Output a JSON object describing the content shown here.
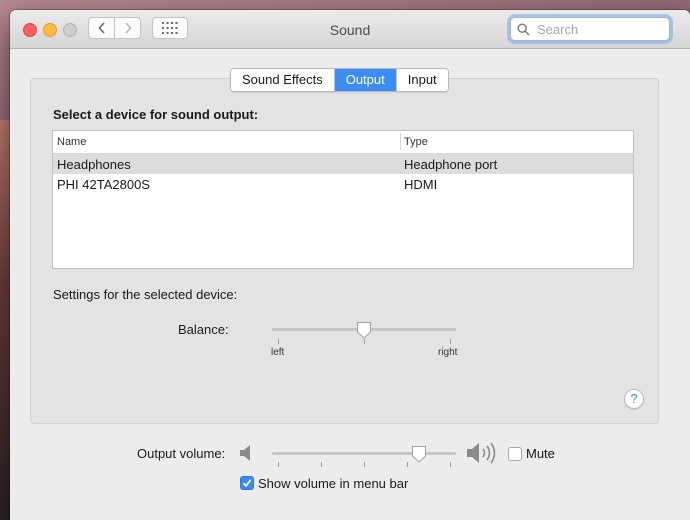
{
  "window": {
    "title": "Sound"
  },
  "search": {
    "placeholder": "Search",
    "value": ""
  },
  "tabs": [
    {
      "label": "Sound Effects",
      "active": false
    },
    {
      "label": "Output",
      "active": true
    },
    {
      "label": "Input",
      "active": false
    }
  ],
  "output": {
    "heading": "Select a device for sound output:",
    "columns": {
      "name": "Name",
      "type": "Type"
    },
    "devices": [
      {
        "name": "Headphones",
        "type": "Headphone port",
        "selected": true
      },
      {
        "name": "PHI 42TA2800S",
        "type": "HDMI",
        "selected": false
      }
    ],
    "settings_label": "Settings for the selected device:",
    "balance": {
      "label": "Balance:",
      "left_label": "left",
      "right_label": "right",
      "value": 0.5
    }
  },
  "help": {
    "label": "?"
  },
  "footer": {
    "output_volume_label": "Output volume:",
    "volume_value": 0.8,
    "mute_label": "Mute",
    "mute_checked": false,
    "show_volume_label": "Show volume in menu bar",
    "show_volume_checked": true
  },
  "colors": {
    "accent": "#3b8cf5",
    "selected_row": "#dcdcdc"
  },
  "icons": {
    "back": "chevron-left-icon",
    "forward": "chevron-right-icon",
    "show_all": "grid-icon",
    "search": "search-icon",
    "volume_low": "speaker-low-icon",
    "volume_high": "speaker-high-icon"
  }
}
